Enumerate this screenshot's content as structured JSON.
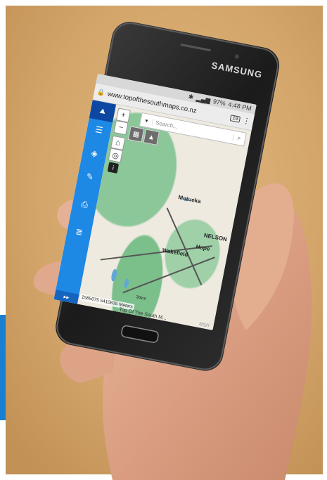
{
  "phone": {
    "brand": "SAMSUNG"
  },
  "status_bar": {
    "battery": "97%",
    "time": "4:48 PM"
  },
  "browser": {
    "url": "www.topofthesouthmaps.co.nz",
    "tab_count": "19",
    "menu_icon": "more-vertical-icon"
  },
  "map_app": {
    "search_placeholder": "Search...",
    "zoom_in": "+",
    "zoom_out": "−",
    "sidebar_collapse": "▸▸",
    "towns": [
      "Motueka",
      "NELSON",
      "Hope",
      "Wakefield"
    ],
    "coordinates": "1585075 5410835 Meters",
    "scale": "30km",
    "attribution": "Top Of The South M...",
    "esri_logo": "esri"
  },
  "colors": {
    "sidebar": "#1e88e5",
    "sidebar_top": "#0d47a1",
    "forest": "#8cc79a",
    "land": "#eeeae0"
  }
}
